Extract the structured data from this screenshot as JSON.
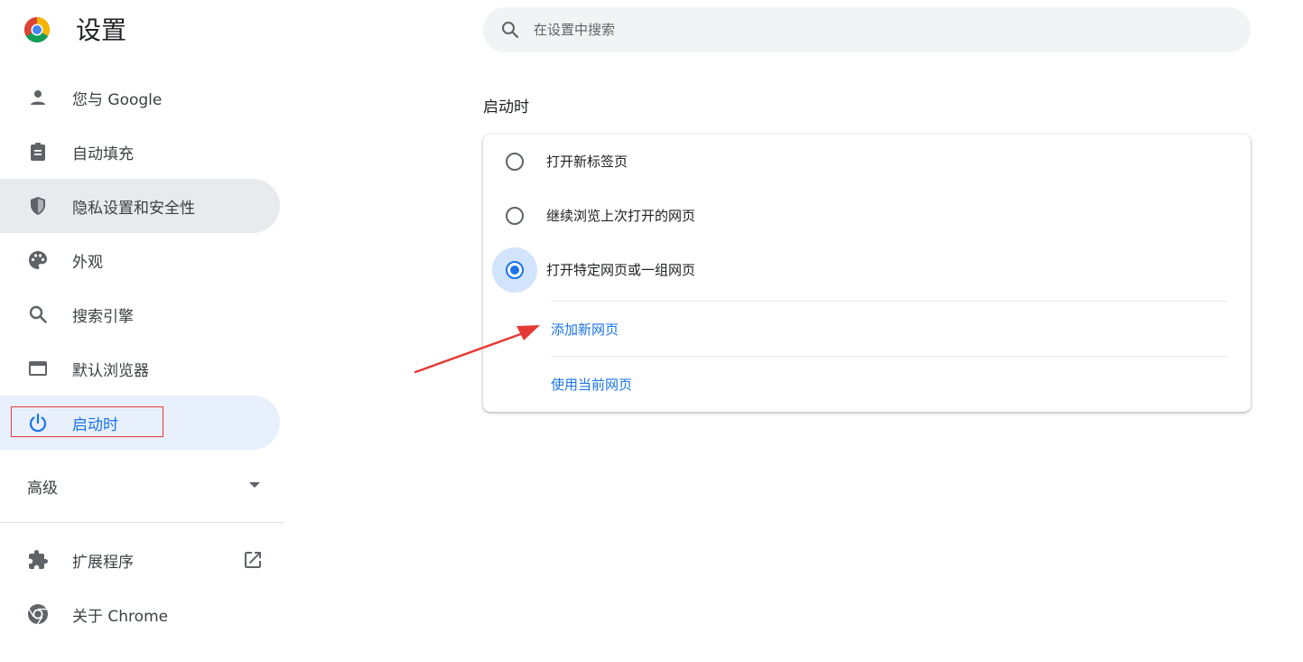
{
  "header": {
    "title": "设置",
    "logo_icon": "chrome-logo"
  },
  "search": {
    "placeholder": "在设置中搜索",
    "value": ""
  },
  "sidebar": {
    "items": [
      {
        "label": "您与 Google",
        "icon": "person-icon"
      },
      {
        "label": "自动填充",
        "icon": "clipboard-icon"
      },
      {
        "label": "隐私设置和安全性",
        "icon": "shield-icon"
      },
      {
        "label": "外观",
        "icon": "palette-icon"
      },
      {
        "label": "搜索引擎",
        "icon": "search-icon"
      },
      {
        "label": "默认浏览器",
        "icon": "browser-window-icon"
      },
      {
        "label": "启动时",
        "icon": "power-icon"
      }
    ],
    "selected_index": 6,
    "hovered_index": 2,
    "advanced_label": "高级",
    "extensions_label": "扩展程序",
    "about_label": "关于 Chrome"
  },
  "main": {
    "section_title": "启动时",
    "options": [
      {
        "label": "打开新标签页",
        "checked": false
      },
      {
        "label": "继续浏览上次打开的网页",
        "checked": false
      },
      {
        "label": "打开特定网页或一组网页",
        "checked": true
      }
    ],
    "add_page_label": "添加新网页",
    "use_current_label": "使用当前网页"
  },
  "colors": {
    "accent": "#1a73e8",
    "selected_bg": "#e8f0fe",
    "annotation_red": "#e53935"
  }
}
